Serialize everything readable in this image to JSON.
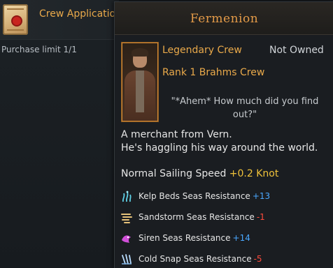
{
  "shop_item": {
    "title": "Crew Application",
    "purchase_limit": "Purchase limit 1/1",
    "icon": "crew-application-scroll-icon"
  },
  "tooltip": {
    "name": "Fermenion",
    "grade": "Legendary Crew",
    "owned_status": "Not Owned",
    "rank": "Rank 1 Brahms Crew",
    "quote": "\"*Ahem* How much did you find out?\"",
    "description_lines": [
      "A merchant from Vern.",
      "He's haggling his way around the world."
    ],
    "speed": {
      "label": "Normal Sailing Speed",
      "value": "+0.2 Knot"
    },
    "resistances": [
      {
        "label": "Kelp Beds Seas Resistance",
        "value": "+13",
        "sign": "pos",
        "icon": "kelp-beds-icon"
      },
      {
        "label": "Sandstorm Seas Resistance",
        "value": "-1",
        "sign": "neg",
        "icon": "sandstorm-icon"
      },
      {
        "label": "Siren Seas Resistance",
        "value": "+14",
        "sign": "pos",
        "icon": "siren-icon"
      },
      {
        "label": "Cold Snap Seas Resistance",
        "value": "-5",
        "sign": "neg",
        "icon": "cold-snap-icon"
      }
    ]
  },
  "colors": {
    "accent_orange": "#e9a94a",
    "speed_yellow": "#f0c23a",
    "positive_blue": "#4aa8ff",
    "negative_red": "#ff4a3c"
  }
}
